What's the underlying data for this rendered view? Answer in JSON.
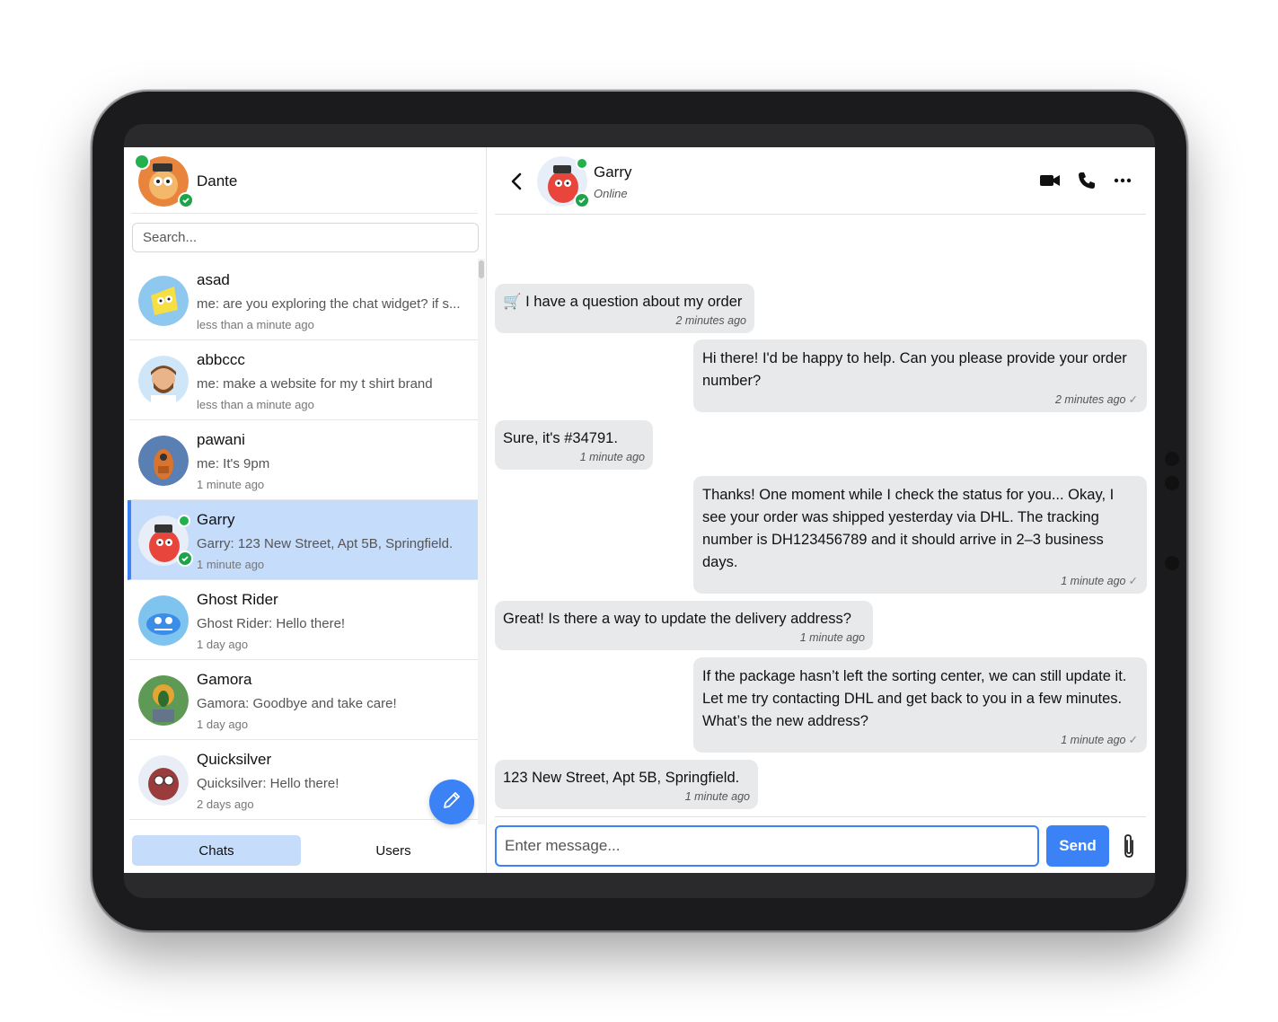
{
  "current_user": {
    "name": "Dante"
  },
  "search": {
    "placeholder": "Search..."
  },
  "conversations": [
    {
      "name": "asad",
      "preview": "me: are you exploring the chat widget? if s...",
      "time": "less than a minute ago"
    },
    {
      "name": "abbccc",
      "preview": "me: make a website for my t shirt brand",
      "time": "less than a minute ago"
    },
    {
      "name": "pawani",
      "preview": "me: It's 9pm",
      "time": "1 minute ago"
    },
    {
      "name": "Garry",
      "preview": "Garry: 123 New Street, Apt 5B, Springfield.",
      "time": "1 minute ago"
    },
    {
      "name": "Ghost Rider",
      "preview": "Ghost Rider: Hello there!",
      "time": "1 day ago"
    },
    {
      "name": "Gamora",
      "preview": "Gamora: Goodbye and take care!",
      "time": "1 day ago"
    },
    {
      "name": "Quicksilver",
      "preview": "Quicksilver: Hello there!",
      "time": "2 days ago"
    }
  ],
  "tabs": {
    "chats": "Chats",
    "users": "Users"
  },
  "chat": {
    "name": "Garry",
    "status": "Online",
    "messages": [
      {
        "dir": "in",
        "text": "🛒 I have a question about my order",
        "time": "2 minutes ago"
      },
      {
        "dir": "out",
        "text": "Hi there! I'd be happy to help. Can you please provide your order number?",
        "time": "2 minutes ago"
      },
      {
        "dir": "in",
        "text": "Sure, it's #34791.",
        "time": "1 minute ago"
      },
      {
        "dir": "out",
        "text": "Thanks! One moment while I check the status for you... Okay, I see your order was shipped yesterday via DHL. The tracking number is DH123456789 and it should arrive in 2–3 business days.",
        "time": "1 minute ago"
      },
      {
        "dir": "in",
        "text": "Great! Is there a way to update the delivery address?",
        "time": "1 minute ago"
      },
      {
        "dir": "out",
        "text": "If the package hasn’t left the sorting center, we can still update it. Let me try contacting DHL and get back to you in a few minutes. What’s the new address?",
        "time": "1 minute ago"
      },
      {
        "dir": "in",
        "text": "123 New Street, Apt 5B, Springfield.",
        "time": "1 minute ago"
      }
    ]
  },
  "composer": {
    "placeholder": "Enter message...",
    "send_label": "Send"
  },
  "icons": {
    "back": "chevron-left-icon",
    "video": "video-camera-icon",
    "call": "phone-icon",
    "more": "more-horizontal-icon",
    "compose": "pencil-icon",
    "attach": "paperclip-icon",
    "read": "check-icon"
  },
  "colors": {
    "accent": "#3b82f6",
    "active_row": "#c5dcfb",
    "bubble": "#e8e9eb",
    "online": "#22b14c"
  }
}
